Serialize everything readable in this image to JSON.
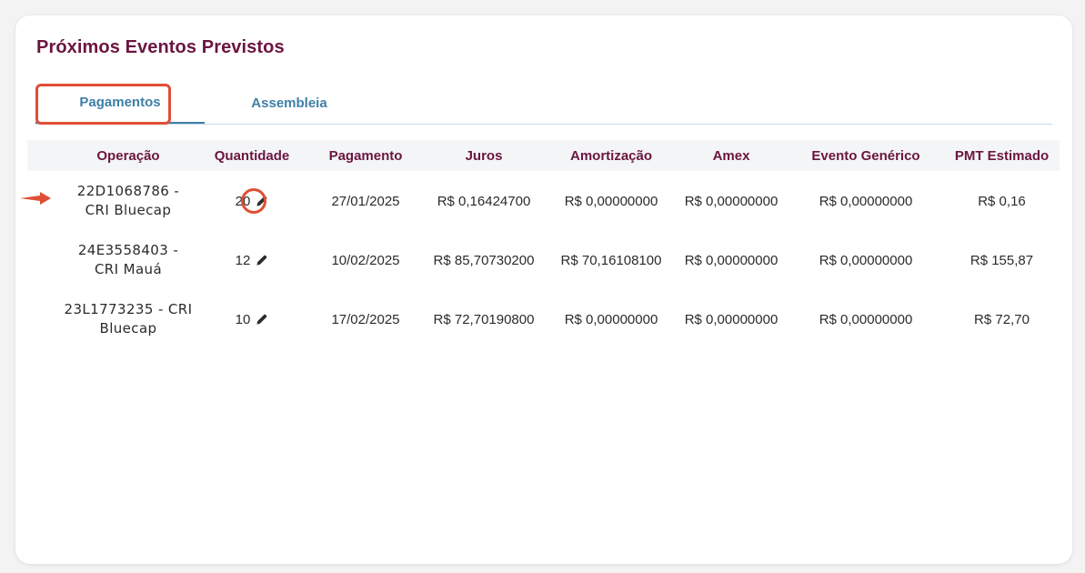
{
  "card": {
    "title": "Próximos Eventos Previstos"
  },
  "tabs": [
    {
      "label": "Pagamentos",
      "active": true
    },
    {
      "label": "Assembleia",
      "active": false
    }
  ],
  "table": {
    "headers": [
      "Operação",
      "Quantidade",
      "Pagamento",
      "Juros",
      "Amortização",
      "Amex",
      "Evento Genérico",
      "PMT Estimado"
    ],
    "rows": [
      {
        "operacao_line1": "22D1068786 -",
        "operacao_line2": "CRI Bluecap",
        "quantidade": "20",
        "pagamento": "27/01/2025",
        "juros": "R$ 0,16424700",
        "amortizacao": "R$ 0,00000000",
        "amex": "R$ 0,00000000",
        "evento_generico": "R$ 0,00000000",
        "pmt_estimado": "R$ 0,16"
      },
      {
        "operacao_line1": "24E3558403 -",
        "operacao_line2": "CRI Mauá",
        "quantidade": "12",
        "pagamento": "10/02/2025",
        "juros": "R$ 85,70730200",
        "amortizacao": "R$ 70,16108100",
        "amex": "R$ 0,00000000",
        "evento_generico": "R$ 0,00000000",
        "pmt_estimado": "R$ 155,87"
      },
      {
        "operacao_line1": "23L1773235 - CRI",
        "operacao_line2": "Bluecap",
        "quantidade": "10",
        "pagamento": "17/02/2025",
        "juros": "R$ 72,70190800",
        "amortizacao": "R$ 0,00000000",
        "amex": "R$ 0,00000000",
        "evento_generico": "R$ 0,00000000",
        "pmt_estimado": "R$ 72,70"
      }
    ]
  },
  "icons": {
    "edit": "pencil-icon",
    "annotation_arrow": "arrow-right-icon"
  },
  "colors": {
    "title": "#6b1540",
    "tab_text": "#3e7fa6",
    "highlight": "#e04e35"
  }
}
